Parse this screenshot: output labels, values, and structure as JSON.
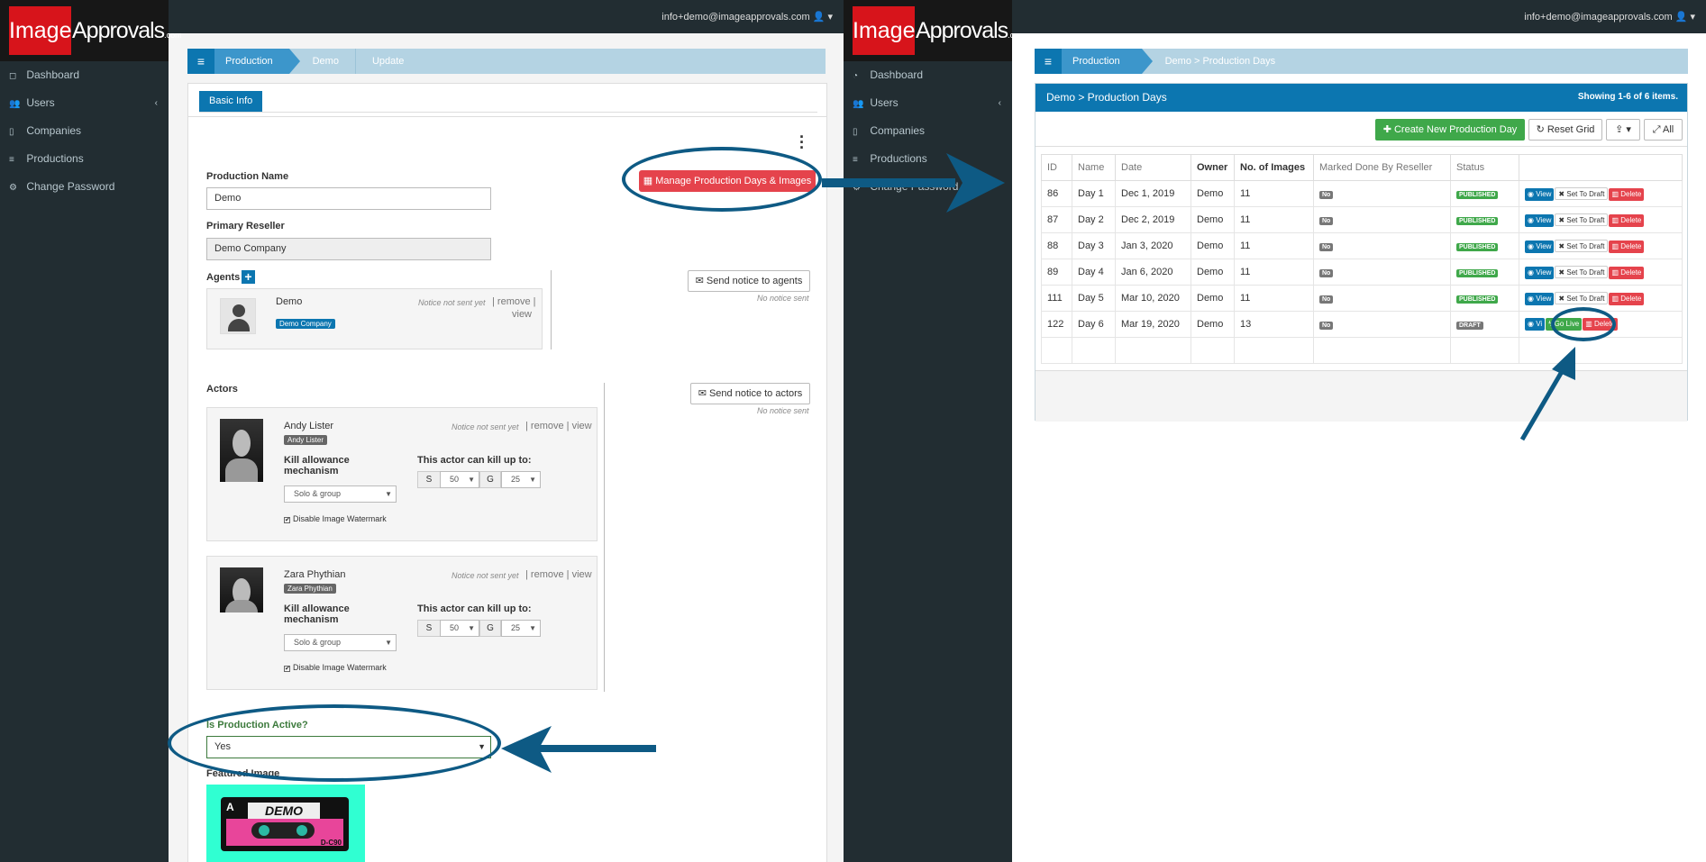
{
  "brand": {
    "logo_a": "Image",
    "logo_b": "Approvals",
    "logo_c": ".com"
  },
  "user_email": "info+demo@imageapprovals.com",
  "nav": [
    {
      "label": "Dashboard",
      "icon": "dashboard-icon"
    },
    {
      "label": "Users",
      "icon": "users-icon"
    },
    {
      "label": "Companies",
      "icon": "building-icon"
    },
    {
      "label": "Productions",
      "icon": "list-icon"
    },
    {
      "label": "Change Password",
      "icon": "gear-icon"
    }
  ],
  "left": {
    "breadcrumb": [
      "Production",
      "Demo",
      "Update"
    ],
    "tab": "Basic Info",
    "manage_button": "Manage Production Days & Images",
    "production_name_label": "Production Name",
    "production_name_value": "Demo",
    "primary_reseller_label": "Primary Reseller",
    "primary_reseller_value": "Demo Company",
    "agents_label": "Agents",
    "agent": {
      "name": "Demo",
      "company": "Demo Company",
      "notice": "Notice not sent yet",
      "remove": "remove",
      "view": "view"
    },
    "send_agents": "Send notice to agents",
    "no_notice": "No notice sent",
    "actors_label": "Actors",
    "send_actors": "Send notice to actors",
    "actors": [
      {
        "name": "Andy Lister",
        "badge": "Andy Lister",
        "notice": "Notice not sent yet",
        "remove": "remove",
        "view": "view",
        "kill_label": "Kill allowance mechanism",
        "kill_value": "Solo & group",
        "can_kill": "This actor can kill up to:",
        "s": "S",
        "s_val": "50",
        "g": "G",
        "g_val": "25",
        "watermark": "Disable Image Watermark"
      },
      {
        "name": "Zara Phythian",
        "badge": "Zara Phythian",
        "notice": "Notice not sent yet",
        "remove": "remove",
        "view": "view",
        "kill_label": "Kill allowance mechanism",
        "kill_value": "Solo & group",
        "can_kill": "This actor can kill up to:",
        "s": "S",
        "s_val": "50",
        "g": "G",
        "g_val": "25",
        "watermark": "Disable Image Watermark"
      }
    ],
    "active_label": "Is Production Active?",
    "active_value": "Yes",
    "featured_label": "Featured Image",
    "cassette": {
      "side": "A",
      "label": "DEMO",
      "code": "D-C90"
    }
  },
  "right": {
    "breadcrumb": [
      "Production",
      "Demo > Production Days"
    ],
    "panel_title": "Demo > Production Days",
    "showing": "Showing 1-6 of 6 items.",
    "create_btn": "Create New Production Day",
    "reset_btn": "Reset Grid",
    "export_btn": "",
    "all_btn": "All",
    "columns": [
      "ID",
      "Name",
      "Date",
      "Owner",
      "No. of Images",
      "Marked Done By Reseller",
      "Status",
      ""
    ],
    "rows": [
      {
        "id": "86",
        "name": "Day 1",
        "date": "Dec 1, 2019",
        "owner": "Demo",
        "images": "11",
        "done": "No",
        "status": "PUBLISHED"
      },
      {
        "id": "87",
        "name": "Day 2",
        "date": "Dec 2, 2019",
        "owner": "Demo",
        "images": "11",
        "done": "No",
        "status": "PUBLISHED"
      },
      {
        "id": "88",
        "name": "Day 3",
        "date": "Jan 3, 2020",
        "owner": "Demo",
        "images": "11",
        "done": "No",
        "status": "PUBLISHED"
      },
      {
        "id": "89",
        "name": "Day 4",
        "date": "Jan 6, 2020",
        "owner": "Demo",
        "images": "11",
        "done": "No",
        "status": "PUBLISHED"
      },
      {
        "id": "111",
        "name": "Day 5",
        "date": "Mar 10, 2020",
        "owner": "Demo",
        "images": "11",
        "done": "No",
        "status": "PUBLISHED"
      },
      {
        "id": "122",
        "name": "Day 6",
        "date": "Mar 19, 2020",
        "owner": "Demo",
        "images": "13",
        "done": "No",
        "status": "DRAFT"
      }
    ],
    "action_view": "View",
    "action_draft": "Set To Draft",
    "action_delete": "Delete",
    "action_golive": "Go Live",
    "action_view_short": "Vi"
  },
  "colors": {
    "accent": "#0c76b0",
    "danger": "#e5434c",
    "success": "#3fa84a",
    "sidebar": "#222d32",
    "annotation": "#0e5a84"
  }
}
